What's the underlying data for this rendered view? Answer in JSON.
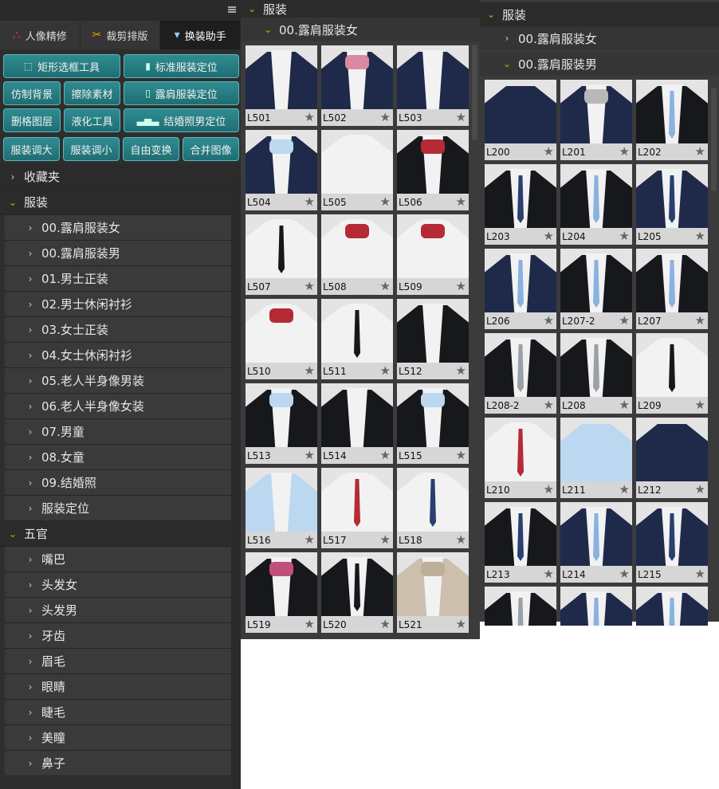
{
  "left": {
    "tabs": [
      {
        "label": "人像精修",
        "icon": "portrait-icon"
      },
      {
        "label": "裁剪排版",
        "icon": "scissors-icon"
      },
      {
        "label": "换装助手",
        "icon": "suit-icon",
        "active": true
      }
    ],
    "tools": [
      {
        "label": "矩形选框工具",
        "icon": "marquee-icon"
      },
      {
        "label": "标准服装定位",
        "icon": "suit-icon"
      },
      {
        "label": "仿制背景"
      },
      {
        "label": "擦除素材"
      },
      {
        "label": "露肩服装定位",
        "icon": "shirt-icon"
      },
      {
        "label": "删格图层"
      },
      {
        "label": "液化工具"
      },
      {
        "label": "结婚照男定位",
        "icon": "wedding-icon"
      }
    ],
    "tools_row4": [
      "服装调大",
      "服装调小",
      "自由变换",
      "合并图像"
    ],
    "tree": [
      {
        "type": "cat",
        "label": "收藏夹",
        "open": false
      },
      {
        "type": "cat",
        "label": "服装",
        "open": true
      },
      {
        "type": "sub",
        "label": "00.露肩服装女"
      },
      {
        "type": "sub",
        "label": "00.露肩服装男"
      },
      {
        "type": "sub",
        "label": "01.男士正装"
      },
      {
        "type": "sub",
        "label": "02.男士休闲衬衫"
      },
      {
        "type": "sub",
        "label": "03.女士正装"
      },
      {
        "type": "sub",
        "label": "04.女士休闲衬衫"
      },
      {
        "type": "sub",
        "label": "05.老人半身像男装"
      },
      {
        "type": "sub",
        "label": "06.老人半身像女装"
      },
      {
        "type": "sub",
        "label": "07.男童"
      },
      {
        "type": "sub",
        "label": "08.女童"
      },
      {
        "type": "sub",
        "label": "09.结婚照"
      },
      {
        "type": "sub",
        "label": "服装定位"
      },
      {
        "type": "cat",
        "label": "五官",
        "open": true
      },
      {
        "type": "sub",
        "label": "嘴巴"
      },
      {
        "type": "sub",
        "label": "头发女"
      },
      {
        "type": "sub",
        "label": "头发男"
      },
      {
        "type": "sub",
        "label": "牙齿"
      },
      {
        "type": "sub",
        "label": "眉毛"
      },
      {
        "type": "sub",
        "label": "眼睛"
      },
      {
        "type": "sub",
        "label": "睫毛"
      },
      {
        "type": "sub",
        "label": "美瞳"
      },
      {
        "type": "sub",
        "label": "鼻子"
      }
    ]
  },
  "middle": {
    "header": "服装",
    "subheader": "00.露肩服装女",
    "items": [
      {
        "label": "L501",
        "style": "vest"
      },
      {
        "label": "L502",
        "style": "vest-bow"
      },
      {
        "label": "L503",
        "style": "vest"
      },
      {
        "label": "L504",
        "style": "vest-bow-blue"
      },
      {
        "label": "L505",
        "style": "white-vest"
      },
      {
        "label": "L506",
        "style": "suit-redbow"
      },
      {
        "label": "L507",
        "style": "white-blacktie"
      },
      {
        "label": "L508",
        "style": "white-redbow"
      },
      {
        "label": "L509",
        "style": "white-redbow"
      },
      {
        "label": "L510",
        "style": "white-redbow"
      },
      {
        "label": "L511",
        "style": "white-ribbon"
      },
      {
        "label": "L512",
        "style": "suit-white"
      },
      {
        "label": "L513",
        "style": "suit-bluebow"
      },
      {
        "label": "L514",
        "style": "suit-white"
      },
      {
        "label": "L515",
        "style": "suit-bluebow"
      },
      {
        "label": "L516",
        "style": "bluevest"
      },
      {
        "label": "L517",
        "style": "white-redtie"
      },
      {
        "label": "L518",
        "style": "white-navytie"
      },
      {
        "label": "L519",
        "style": "suit-scarf"
      },
      {
        "label": "L520",
        "style": "suit-ribbon"
      },
      {
        "label": "L521",
        "style": "beige-bow"
      }
    ]
  },
  "right": {
    "header": "服装",
    "collapsed_sub": "00.露肩服装女",
    "subheader": "00.露肩服装男",
    "items": [
      {
        "label": "L200",
        "style": "navy-shirt"
      },
      {
        "label": "L201",
        "style": "vest-bowtie"
      },
      {
        "label": "L202",
        "style": "suit-bluetie"
      },
      {
        "label": "L203",
        "style": "suit-stripetie"
      },
      {
        "label": "L204",
        "style": "suit-lightblue"
      },
      {
        "label": "L205",
        "style": "navy-darktie"
      },
      {
        "label": "L206",
        "style": "navy-bluetie"
      },
      {
        "label": "L207-2",
        "style": "suit-bluetie"
      },
      {
        "label": "L207",
        "style": "suit-bluetie"
      },
      {
        "label": "L208-2",
        "style": "suit-greytie"
      },
      {
        "label": "L208",
        "style": "suit-greytie"
      },
      {
        "label": "L209",
        "style": "white-blacktie"
      },
      {
        "label": "L210",
        "style": "white-redstripe"
      },
      {
        "label": "L211",
        "style": "lightblue-shirt"
      },
      {
        "label": "L212",
        "style": "navy-shirt"
      },
      {
        "label": "L213",
        "style": "suit-stripetie"
      },
      {
        "label": "L214",
        "style": "navy-bluetie"
      },
      {
        "label": "L215",
        "style": "navy-stripetie"
      },
      {
        "label": "",
        "style": "suit-greytie"
      },
      {
        "label": "",
        "style": "navy-bluetie"
      },
      {
        "label": "",
        "style": "navy-bluetie"
      }
    ]
  },
  "colors": {
    "accent": "#1f6e73",
    "chevron_open": "#e0a800"
  }
}
